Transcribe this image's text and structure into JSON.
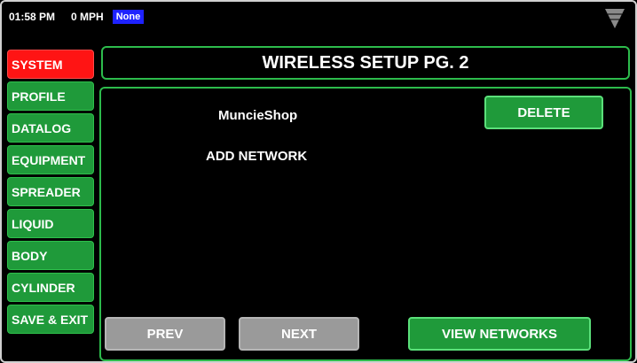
{
  "status": {
    "time": "01:58 PM",
    "speed": "0 MPH",
    "badge": "None",
    "badge_color": "#1e22ff"
  },
  "sidebar": {
    "items": [
      {
        "label": "SYSTEM",
        "active": true
      },
      {
        "label": "PROFILE"
      },
      {
        "label": "DATALOG"
      },
      {
        "label": "EQUIPMENT"
      },
      {
        "label": "SPREADER"
      },
      {
        "label": "LIQUID"
      },
      {
        "label": "BODY"
      },
      {
        "label": "CYLINDER"
      },
      {
        "label": "SAVE & EXIT"
      }
    ]
  },
  "header": {
    "title": "WIRELESS SETUP PG. 2"
  },
  "networks": {
    "items": [
      "MuncieShop"
    ],
    "add_label": "ADD NETWORK",
    "delete_label": "DELETE"
  },
  "footer": {
    "prev_label": "PREV",
    "next_label": "NEXT",
    "view_label": "VIEW NETWORKS"
  },
  "colors": {
    "accent_green": "#1f9a3a",
    "active_red": "#ff1414",
    "disabled_gray": "#9a9a9a"
  },
  "icons": {
    "signal": "wifi-signal-icon"
  }
}
